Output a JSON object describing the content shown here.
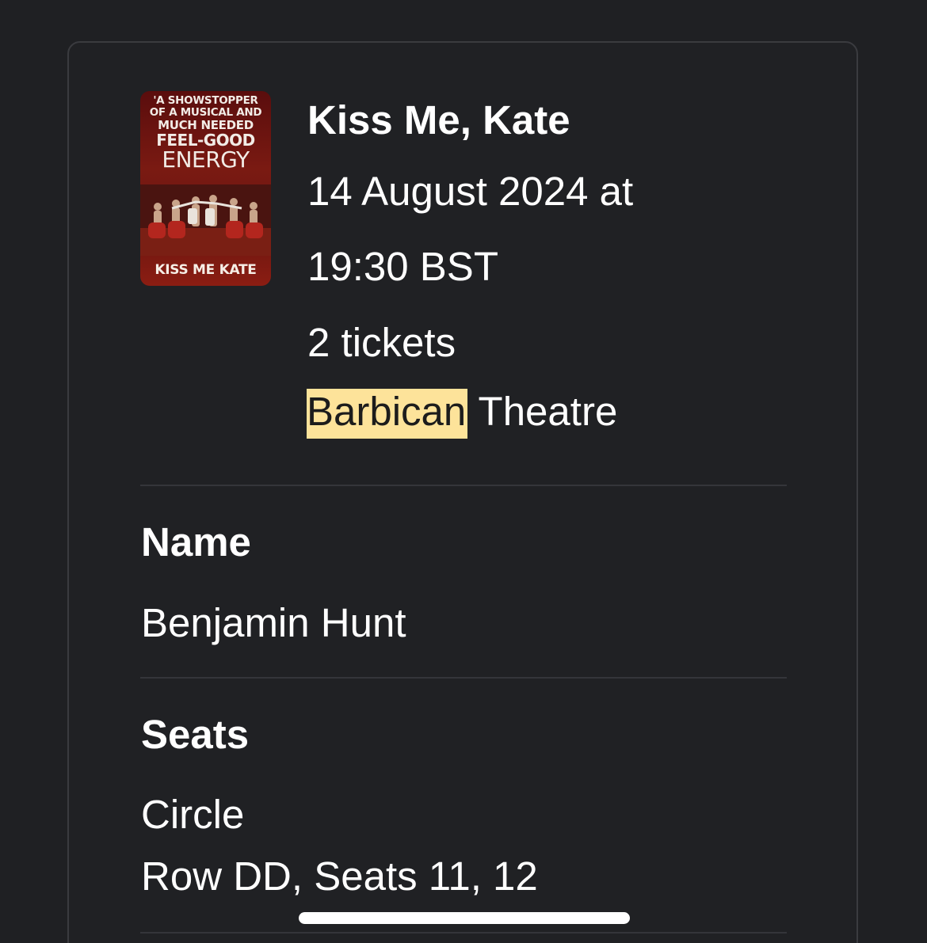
{
  "poster": {
    "quote_line1": "'A SHOWSTOPPER",
    "quote_line2": "OF A MUSICAL AND",
    "quote_line3": "MUCH NEEDED",
    "quote_line4": "FEEL-GOOD",
    "quote_line5": "ENERGY",
    "title": "KISS ME KATE"
  },
  "event": {
    "title": "Kiss Me, Kate",
    "date": "14 August 2024 at",
    "time": "19:30 BST",
    "tickets": "2 tickets",
    "venue_highlighted": "Barbican",
    "venue_rest": " Theatre"
  },
  "name_section": {
    "label": "Name",
    "value": "Benjamin Hunt"
  },
  "seats_section": {
    "label": "Seats",
    "area": "Circle",
    "seats": "Row DD, Seats 11, 12"
  },
  "colors": {
    "background": "#1f2023",
    "highlight": "#fde39a",
    "divider": "#34353a"
  }
}
